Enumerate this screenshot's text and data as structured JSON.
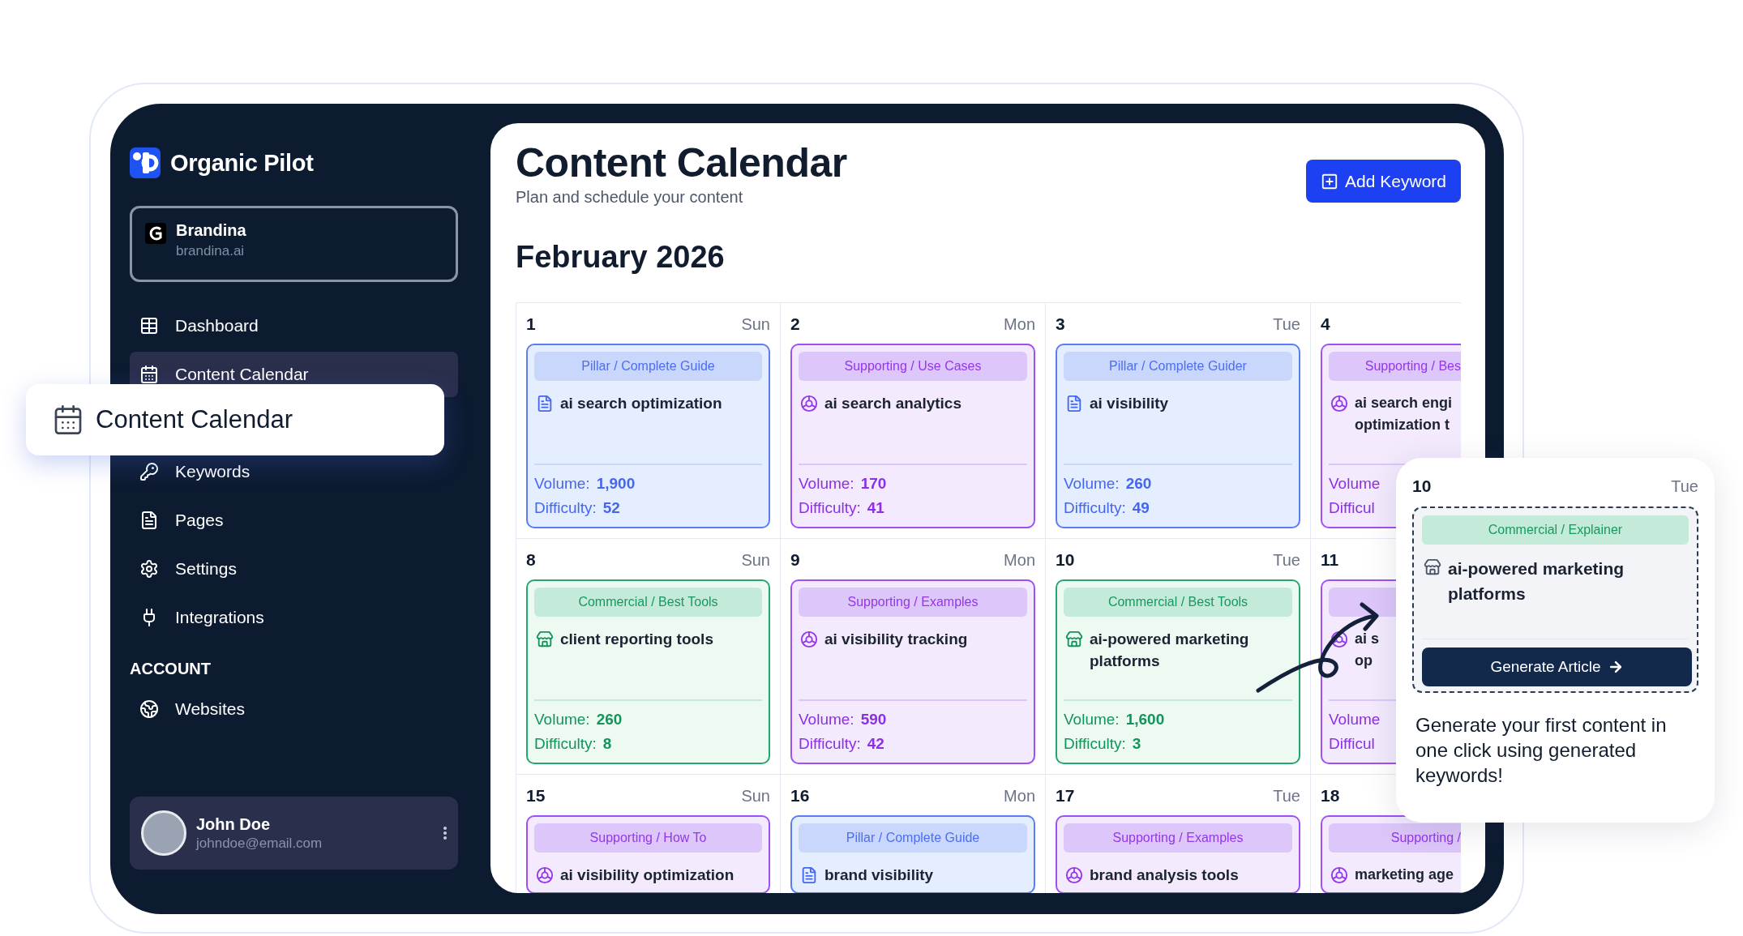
{
  "app": {
    "name": "Organic Pilot"
  },
  "workspace": {
    "name": "Brandina",
    "domain": "brandina.ai"
  },
  "nav": [
    {
      "label": "Dashboard",
      "selected": false
    },
    {
      "label": "Content Calendar",
      "selected": true
    },
    {
      "label": "Keywords",
      "selected": false
    },
    {
      "label": "Pages",
      "selected": false
    },
    {
      "label": "Settings",
      "selected": false
    },
    {
      "label": "Integrations",
      "selected": false
    }
  ],
  "account": {
    "heading": "ACCOUNT",
    "items": [
      {
        "label": "Websites",
        "selected": false
      }
    ]
  },
  "user": {
    "name": "John Doe",
    "email": "johndoe@email.com"
  },
  "callout": {
    "label": "Content Calendar"
  },
  "header": {
    "title": "Content Calendar",
    "subtitle": "Plan and schedule your content",
    "button": "Add Keyword"
  },
  "month": "February 2026",
  "weeks": [
    [
      {
        "date": "1",
        "weekday": "Sun",
        "card": {
          "kind": "pillar",
          "tag": "Pillar / Complete Guide",
          "keyword": "ai search optimization",
          "volume_label": "Volume:",
          "volume": "1,900",
          "difficulty_label": "Difficulty:",
          "difficulty": "52"
        }
      },
      {
        "date": "2",
        "weekday": "Mon",
        "card": {
          "kind": "supporting",
          "tag": "Supporting / Use Cases",
          "keyword": "ai search analytics",
          "volume_label": "Volume:",
          "volume": "170",
          "difficulty_label": "Difficulty:",
          "difficulty": "41"
        }
      },
      {
        "date": "3",
        "weekday": "Tue",
        "card": {
          "kind": "pillar",
          "tag": "Pillar / Complete Guider",
          "keyword": "ai visibility",
          "volume_label": "Volume:",
          "volume": "260",
          "difficulty_label": "Difficulty:",
          "difficulty": "49"
        }
      },
      {
        "date": "4",
        "card": {
          "kind": "supporting",
          "tag": "Supporting / Bes",
          "keyword": "ai search engi optimization t",
          "volume_label": "Volume",
          "difficulty_label": "Difficul"
        }
      }
    ],
    [
      {
        "date": "8",
        "weekday": "Sun",
        "card": {
          "kind": "commercial",
          "tag": "Commercial / Best Tools",
          "keyword": "client reporting tools",
          "volume_label": "Volume:",
          "volume": "260",
          "difficulty_label": "Difficulty:",
          "difficulty": "8"
        }
      },
      {
        "date": "9",
        "weekday": "Mon",
        "card": {
          "kind": "supporting",
          "tag": "Supporting / Examples",
          "keyword": "ai visibility tracking",
          "volume_label": "Volume:",
          "volume": "590",
          "difficulty_label": "Difficulty:",
          "difficulty": "42"
        }
      },
      {
        "date": "10",
        "weekday": "Tue",
        "card": {
          "kind": "commercial",
          "tag": "Commercial / Best Tools",
          "keyword": "ai-powered marketing platforms",
          "volume_label": "Volume:",
          "volume": "1,600",
          "difficulty_label": "Difficulty:",
          "difficulty": "3"
        }
      },
      {
        "date": "11",
        "card": {
          "kind": "supporting",
          "keyword": "ai s op",
          "volume_label": "Volume",
          "difficulty_label": "Difficul"
        }
      }
    ],
    [
      {
        "date": "15",
        "weekday": "Sun",
        "card": {
          "kind": "supporting",
          "tag": "Supporting / How To",
          "keyword": "ai visibility optimization"
        }
      },
      {
        "date": "16",
        "weekday": "Mon",
        "card": {
          "kind": "pillar",
          "tag": "Pillar / Complete Guide",
          "keyword": "brand visibility"
        }
      },
      {
        "date": "17",
        "weekday": "Tue",
        "card": {
          "kind": "supporting",
          "tag": "Supporting / Examples",
          "keyword": "brand analysis tools"
        }
      },
      {
        "date": "18",
        "card": {
          "kind": "supporting",
          "tag": "Supporting /",
          "keyword": "marketing age"
        }
      }
    ]
  ],
  "popup": {
    "date": "10",
    "weekday": "Tue",
    "kind": "commercial",
    "tag": "Commercial / Explainer",
    "keyword": "ai-powered marketing platforms",
    "button": "Generate Article",
    "message": "Generate your first content in one click using generated keywords!"
  }
}
